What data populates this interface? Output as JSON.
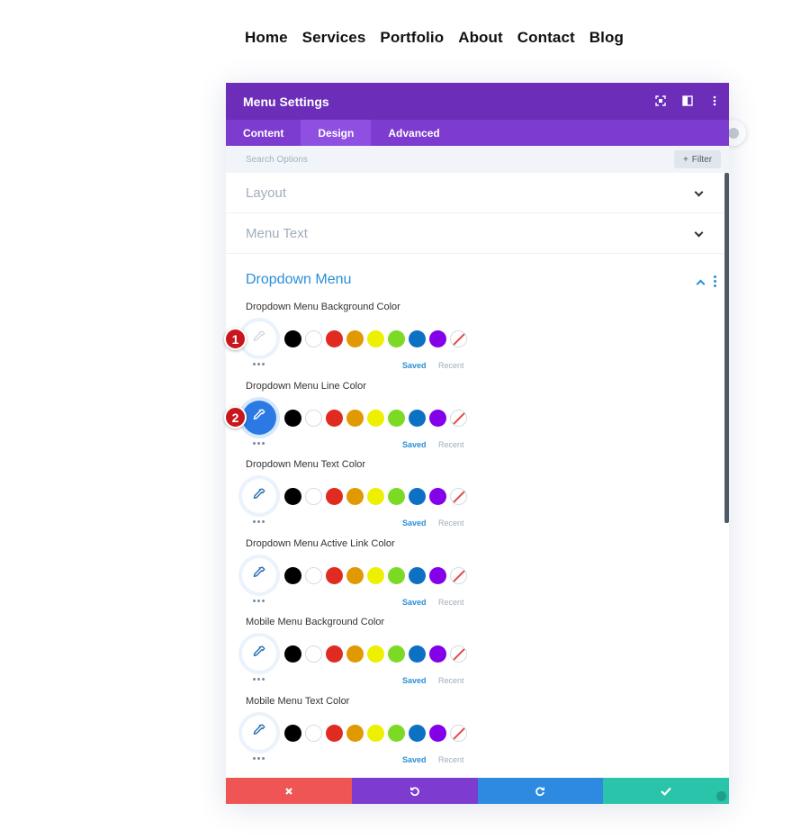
{
  "nav": [
    "Home",
    "Services",
    "Portfolio",
    "About",
    "Contact",
    "Blog"
  ],
  "modal": {
    "title": "Menu Settings",
    "head_icons": [
      "focus-icon",
      "sidebar-layout-icon",
      "kebab-menu-icon"
    ],
    "tabs": [
      "Content",
      "Design",
      "Advanced"
    ],
    "active_tab": "Design",
    "search_placeholder": "Search Options",
    "filter_label": "Filter",
    "sections": {
      "layout": "Layout",
      "menu_text": "Menu Text",
      "dropdown": "Dropdown Menu"
    },
    "fields": [
      "Dropdown Menu Background Color",
      "Dropdown Menu Line Color",
      "Dropdown Menu Text Color",
      "Dropdown Menu Active Link Color",
      "Mobile Menu Background Color",
      "Mobile Menu Text Color"
    ],
    "saved_label": "Saved",
    "recent_label": "Recent",
    "swatch_colors": [
      "#000000",
      "#ffffff",
      "#e02b20",
      "#e09900",
      "#edf000",
      "#7cda24",
      "#0c71c3",
      "#8300e9"
    ],
    "badges": [
      "1",
      "2"
    ],
    "footer_icons": [
      "close-icon",
      "undo-icon",
      "redo-icon",
      "check-icon"
    ],
    "accent": "#6c2eb9"
  }
}
